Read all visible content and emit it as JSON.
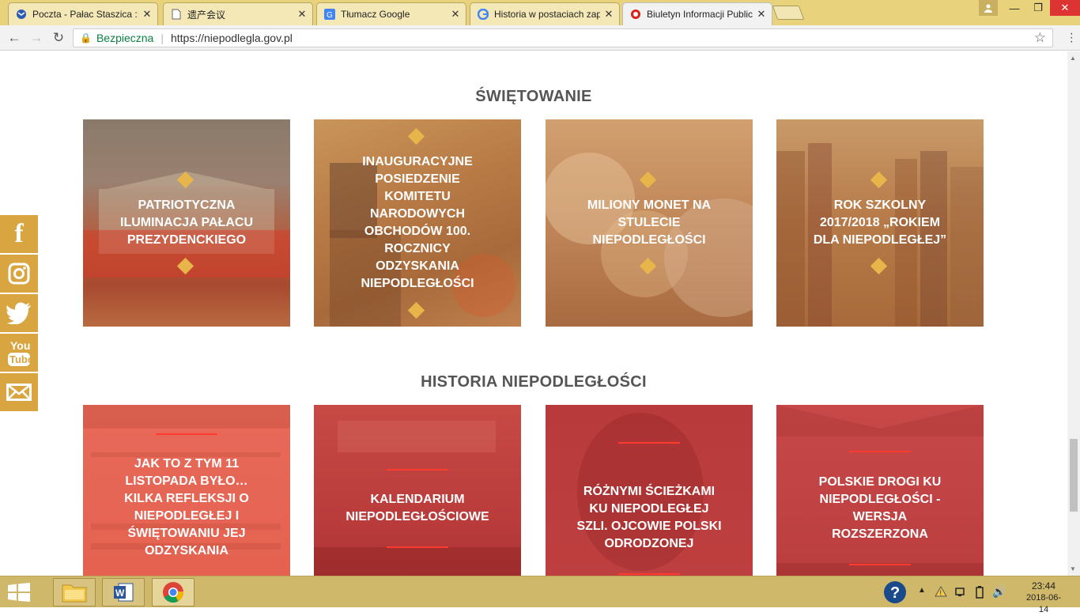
{
  "browser": {
    "tabs": [
      {
        "title": "Poczta - Pałac Staszica :: W",
        "icon": "mail-icon",
        "active": false
      },
      {
        "title": "遗产会议",
        "icon": "document-icon",
        "active": false
      },
      {
        "title": "Tłumacz Google",
        "icon": "translate-icon",
        "active": false
      },
      {
        "title": "Historia w postaciach zap",
        "icon": "google-icon",
        "active": false
      },
      {
        "title": "Biuletyn Informacji Public",
        "icon": "bip-icon",
        "active": true
      }
    ],
    "security_label": "Bezpieczna",
    "url": "https://niepodlegla.gov.pl"
  },
  "page": {
    "section1": {
      "heading": "ŚWIĘTOWANIE",
      "tiles": [
        {
          "title": "PATRIOTYCZNA ILUMINACJA PAŁACU PREZYDENCKIEGO"
        },
        {
          "title": "INAUGURACYJNE POSIEDZENIE KOMITETU NARODOWYCH OBCHODÓW 100. ROCZNICY ODZYSKANIA NIEPODLEGŁOŚCI"
        },
        {
          "title": "MILIONY MONET NA STULECIE NIEPODLEGŁOŚCI"
        },
        {
          "title": "ROK SZKOLNY 2017/2018 „ROKIEM DLA NIEPODLEGŁEJ”"
        }
      ]
    },
    "section2": {
      "heading": "HISTORIA NIEPODLEGŁOŚCI",
      "tiles": [
        {
          "title": "JAK TO Z TYM 11 LISTOPADA BYŁO… KILKA REFLEKSJI O NIEPODLEGŁEJ I ŚWIĘTOWANIU JEJ ODZYSKANIA"
        },
        {
          "title": "KALENDARIUM NIEPODLEGŁOŚCIOWE"
        },
        {
          "title": "RÓŻNYMI ŚCIEŻKAMI KU NIEPODLEGŁEJ SZLI. OJCOWIE POLSKI ODRODZONEJ"
        },
        {
          "title": "POLSKIE DROGI KU NIEPODLEGŁOŚCI - WERSJA ROZSZERZONA"
        }
      ]
    },
    "social": [
      {
        "name": "facebook-icon",
        "glyph": "f"
      },
      {
        "name": "instagram-icon",
        "glyph": "◎"
      },
      {
        "name": "twitter-icon",
        "glyph": "🐦"
      },
      {
        "name": "youtube-icon",
        "glyph": "You Tube"
      },
      {
        "name": "email-icon",
        "glyph": "✉"
      }
    ],
    "colors": {
      "gold_overlay": "#c8874a",
      "red_overlay": "#d64a42",
      "accent_gold": "#d8a540"
    }
  },
  "taskbar": {
    "time": "23:44",
    "date": "2018-06-14"
  }
}
